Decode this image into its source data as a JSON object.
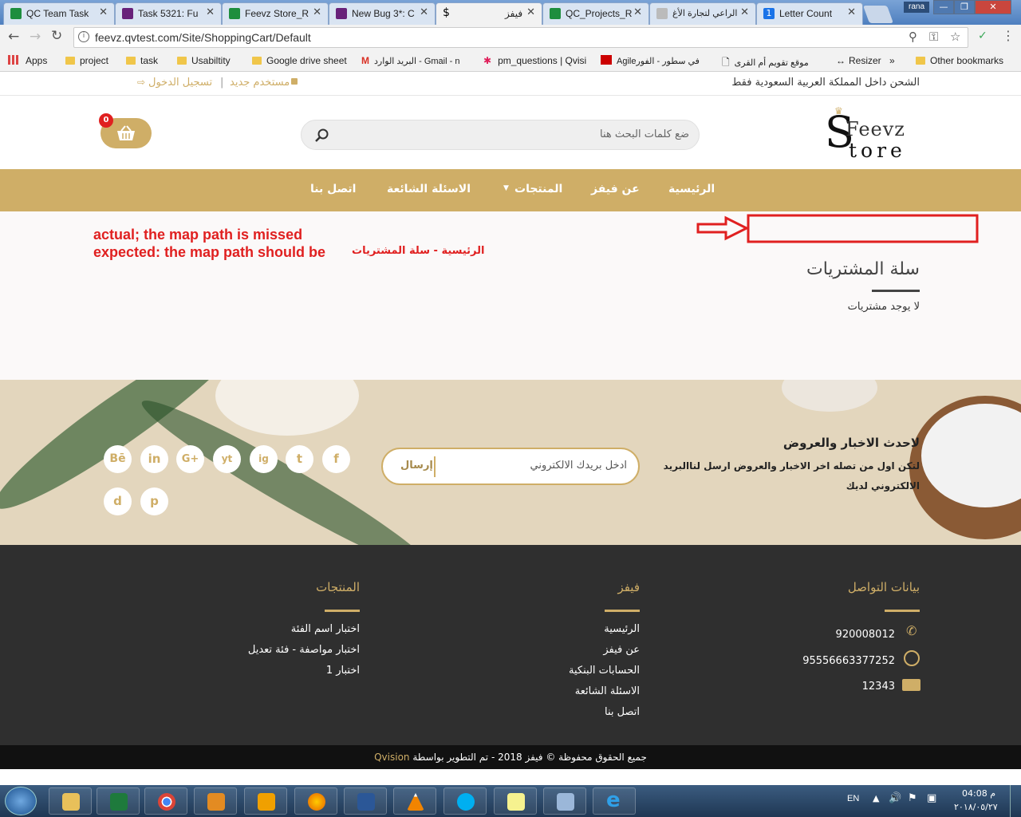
{
  "browser": {
    "tabs": [
      {
        "label": "QC Team Task",
        "color": "#1e8e3e"
      },
      {
        "label": "Task 5321: Fu",
        "color": "#68217a"
      },
      {
        "label": "Feevz Store_R",
        "color": "#1e8e3e"
      },
      {
        "label": "New Bug 3*: C",
        "color": "#68217a"
      },
      {
        "label": "فيفز",
        "color": "#222222"
      },
      {
        "label": "QC_Projects_R",
        "color": "#1e8e3e"
      },
      {
        "label": "الراعي لتجارة الأغ",
        "color": "#999999"
      },
      {
        "label": "Letter Count",
        "color": "#1a73e8"
      }
    ],
    "user": "rana",
    "url": "feevz.qvtest.com/Site/ShoppingCart/Default",
    "bookmarks": [
      "Apps",
      "project",
      "task",
      "Usabiltity",
      "Google drive sheet",
      "البريد الوارد - Gmail - n",
      "pm_questions | Qvisi",
      "Agileفي سطور - الفور",
      "موقع تقويم أم القرى",
      "Resizer",
      "»",
      "Other bookmarks"
    ]
  },
  "site": {
    "shipping_notice": "الشحن داخل المملكة العربية السعودية فقط",
    "new_user": "مستخدم جديد",
    "login": "تسجيل الدخول",
    "search_placeholder": "ضع كلمات البحث هنا",
    "cart_count": "0",
    "logo_top": "Feevz",
    "logo_bottom": "tore",
    "logo_s": "S",
    "nav": [
      "الرئيسية",
      "عن فيفز",
      "المنتجات",
      "الاسئلة الشائعة",
      "اتصل بنا"
    ],
    "annotation_actual": "actual; the map path is missed",
    "annotation_expected": "expected: the map path should be",
    "annotation_path": "الرئيسية - سلة المشتريات",
    "page_title": "سلة المشتريات",
    "empty_msg": "لا يوجد مشتريات",
    "newsletter_title": "لاحدث الاخبار والعروض",
    "newsletter_text_1": "لتكن اول من تصله اخر الاخبار والعروض ارسل لناالبريد",
    "newsletter_text_2": "الالكتروني لديك",
    "email_placeholder": "ادخل بريدك الالكتروني",
    "send": "إرسال",
    "social": [
      "f",
      "t",
      "ig",
      "yt",
      "G+",
      "in",
      "Bē",
      "p",
      "d"
    ],
    "footer": {
      "contact_title": "بيانات التواصل",
      "phone": "920008012",
      "whatsapp": "95556663377252",
      "mail": "12343",
      "feevz_title": "فيفز",
      "feevz_links": [
        "الرئيسية",
        "عن فيفز",
        "الحسابات البنكية",
        "الاسئلة الشائعة",
        "اتصل بنا"
      ],
      "products_title": "المنتجات",
      "product_links": [
        "اختبار اسم الفئة",
        "اختبار مواصفة - فئة تعديل",
        "اختبار 1"
      ]
    },
    "copyright_text": "جميع الحقوق محفوظة © فيفز 2018 - تم التطوير بواسطة",
    "copyright_brand": "Qvision"
  },
  "taskbar": {
    "lang": "EN",
    "time": "04:08 م",
    "date": "٢٠١٨/٠٥/٢٧"
  }
}
